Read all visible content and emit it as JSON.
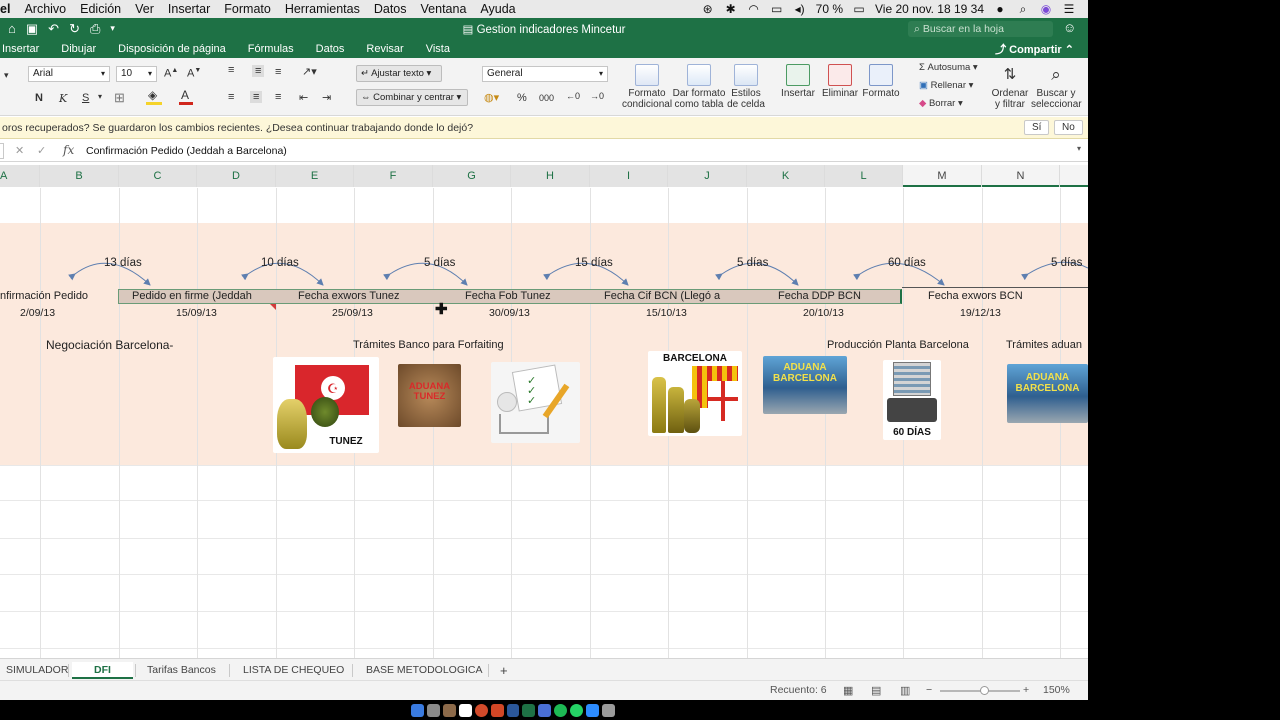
{
  "menubar": {
    "app_fragment": "el",
    "items": [
      "Archivo",
      "Edición",
      "Ver",
      "Insertar",
      "Formato",
      "Herramientas",
      "Datos",
      "Ventana",
      "Ayuda"
    ],
    "battery": "70 %",
    "clock": "Vie 20 nov.  18 19 34"
  },
  "titlebar": {
    "title": "Gestion indicadores Mincetur",
    "search_placeholder": "Buscar en la hoja"
  },
  "ribbon_tabs": {
    "items": [
      "Insertar",
      "Dibujar",
      "Disposición de página",
      "Fórmulas",
      "Datos",
      "Revisar",
      "Vista"
    ],
    "share": "Compartir"
  },
  "ribbon": {
    "font_name": "Arial",
    "font_size": "10",
    "bold": "N",
    "italic": "K",
    "underline": "S",
    "wrap_text": "Ajustar texto",
    "merge_center": "Combinar y centrar",
    "number_format": "General",
    "percent": "%",
    "thousands": "000",
    "cond_format": [
      "Formato",
      "condicional"
    ],
    "table_format": [
      "Dar formato",
      "como tabla"
    ],
    "cell_styles": [
      "Estilos",
      "de celda"
    ],
    "insert": "Insertar",
    "delete": "Eliminar",
    "format": "Formato",
    "autosum": "Autosuma",
    "fill": "Rellenar",
    "clear": "Borrar",
    "sort_filter": [
      "Ordenar",
      "y filtrar"
    ],
    "find_select": [
      "Buscar y",
      "seleccionar"
    ],
    "colors": {
      "accent": "#1e7145",
      "fill_highlight": "#f5d32a",
      "font_red": "#d0261c"
    }
  },
  "infobar": {
    "message": "oros recuperados?   Se guardaron los cambios recientes. ¿Desea continuar trabajando donde lo dejó?",
    "yes": "Sí",
    "no": "No"
  },
  "formula_bar": {
    "fx": "fx",
    "formula": "Confirmación Pedido (Jeddah a Barcelona)"
  },
  "columns": [
    "A",
    "B",
    "C",
    "D",
    "E",
    "F",
    "G",
    "H",
    "I",
    "J",
    "K",
    "L",
    "M",
    "N"
  ],
  "timeline": {
    "days": [
      "13 días",
      "10 días",
      "5 días",
      "15 días",
      "5 días",
      "60 días",
      "5 días"
    ],
    "milestones": [
      {
        "label": "nfirmación Pedido",
        "date": "2/09/13"
      },
      {
        "label": "Pedido en firme (Jeddah",
        "date": "15/09/13"
      },
      {
        "label": "Fecha exwors Tunez",
        "date": "25/09/13"
      },
      {
        "label": "Fecha Fob Tunez",
        "date": "30/09/13"
      },
      {
        "label": "Fecha Cif BCN (Llegó a",
        "date": "15/10/13"
      },
      {
        "label": "Fecha DDP BCN",
        "date": "20/10/13"
      },
      {
        "label": "Fecha exwors BCN",
        "date": "19/12/13"
      }
    ],
    "sections": [
      "Negociación Barcelona-",
      "Trámites Banco para Forfaiting",
      "Producción Planta Barcelona",
      "Trámites aduan"
    ],
    "image_captions": {
      "tunez": "TUNEZ",
      "aduana_tunez": "ADUANA TUNEZ",
      "barcelona": "BARCELONA",
      "aduana_barcelona": "ADUANA BARCELONA",
      "sesenta": "60 DÍAS"
    }
  },
  "sheet_tabs": {
    "items": [
      "SIMULADOR",
      "DFI",
      "Tarifas Bancos",
      "LISTA DE CHEQUEO",
      "BASE METODOLOGICA"
    ],
    "add": "+"
  },
  "status": {
    "count": "Recuento: 6",
    "zoom": "150%"
  }
}
